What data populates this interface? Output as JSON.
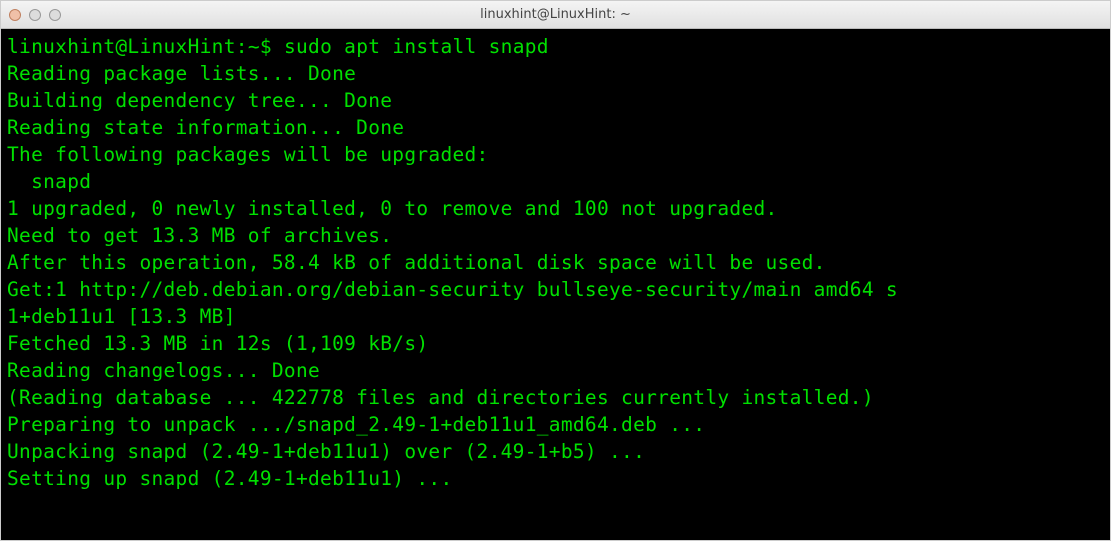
{
  "titlebar": {
    "title": "linuxhint@LinuxHint: ~"
  },
  "terminal": {
    "prompt_user_host": "linuxhint@LinuxHint",
    "prompt_path": "~",
    "prompt_symbol": "$",
    "command": "sudo apt install snapd",
    "output_lines": [
      "Reading package lists... Done",
      "Building dependency tree... Done",
      "Reading state information... Done",
      "The following packages will be upgraded:",
      "  snapd",
      "1 upgraded, 0 newly installed, 0 to remove and 100 not upgraded.",
      "Need to get 13.3 MB of archives.",
      "After this operation, 58.4 kB of additional disk space will be used.",
      "Get:1 http://deb.debian.org/debian-security bullseye-security/main amd64 s",
      "1+deb11u1 [13.3 MB]",
      "Fetched 13.3 MB in 12s (1,109 kB/s)",
      "Reading changelogs... Done",
      "(Reading database ... 422778 files and directories currently installed.)",
      "Preparing to unpack .../snapd_2.49-1+deb11u1_amd64.deb ...",
      "Unpacking snapd (2.49-1+deb11u1) over (2.49-1+b5) ...",
      "Setting up snapd (2.49-1+deb11u1) ..."
    ]
  }
}
